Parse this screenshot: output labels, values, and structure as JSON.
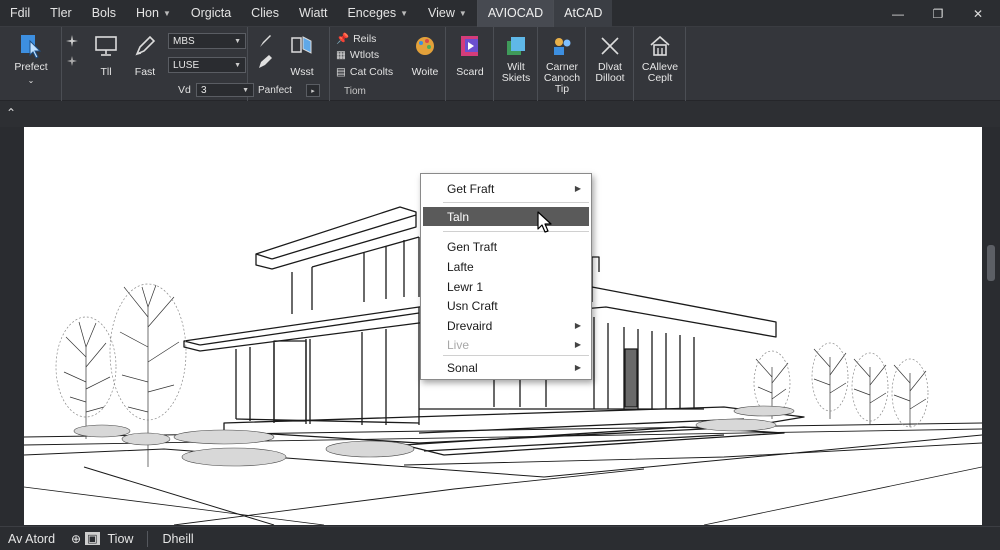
{
  "menu": {
    "items": [
      {
        "label": "Fdil",
        "caret": false
      },
      {
        "label": "Tler",
        "caret": false
      },
      {
        "label": "Bols",
        "caret": false
      },
      {
        "label": "Hon",
        "caret": true
      },
      {
        "label": "Orgicta",
        "caret": false
      },
      {
        "label": "Clies",
        "caret": false
      },
      {
        "label": "Wiatt",
        "caret": false
      },
      {
        "label": "Enceges",
        "caret": true
      },
      {
        "label": "View",
        "caret": true
      }
    ],
    "tabs": [
      "AVIOCAD",
      "AtCAD"
    ]
  },
  "ribbon": {
    "prefect": "Prefect",
    "tl": "Tll",
    "fast": "Fast",
    "dropdown1": "MBS",
    "dropdown2": "LUSE",
    "vd_label": "Vd",
    "dropdown3": "3",
    "wsst": "Wsst",
    "panfect": "Panfect",
    "layer_rows": [
      "Reils",
      "Wtlots",
      "Cat Colts"
    ],
    "woite": "Woite",
    "tiom": "Tiom",
    "scard": "Scard",
    "wilt_skiets": [
      "Wilt",
      "Skiets"
    ],
    "carner_canoch_tip": [
      "Carner",
      "Canoch",
      "Tip"
    ],
    "dlvat_dilloot": [
      "Dlvat",
      "Dilloot"
    ],
    "calleve_ceplt": [
      "CAlleve",
      "Ceplt"
    ]
  },
  "context_menu": {
    "items": [
      {
        "label": "Get Fraft",
        "submenu": true,
        "state": "normal"
      },
      {
        "label": "Taln",
        "submenu": false,
        "state": "highlight"
      },
      {
        "label": "Gen Traft",
        "submenu": false,
        "state": "normal"
      },
      {
        "label": "Lafte",
        "submenu": false,
        "state": "normal"
      },
      {
        "label": "Lewr 1",
        "submenu": false,
        "state": "normal"
      },
      {
        "label": "Usn Craft",
        "submenu": false,
        "state": "normal"
      },
      {
        "label": "Drevaird",
        "submenu": true,
        "state": "normal"
      },
      {
        "label": "Live",
        "submenu": true,
        "state": "disabled"
      },
      {
        "label": "Sonal",
        "submenu": true,
        "state": "normal"
      }
    ]
  },
  "status": {
    "model": "Av Atord",
    "view": "Tiow",
    "dheill": "Dheill"
  },
  "colors": {
    "accent_blue": "#3d8fe0",
    "menubar_bg": "#2b2d31",
    "ribbon_bg": "#34363b",
    "highlight": "#5a5a5a"
  }
}
